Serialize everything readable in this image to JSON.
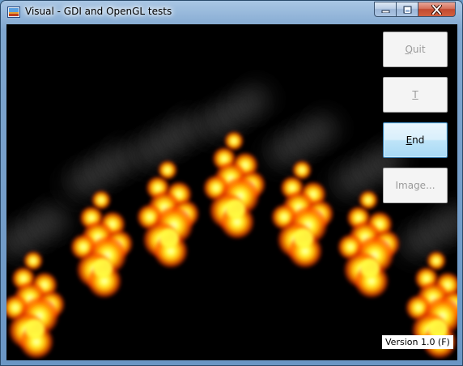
{
  "window": {
    "title": "Visual - GDI and OpenGL tests",
    "controls": {
      "minimize_icon": "minimize-icon",
      "maximize_icon": "maximize-icon",
      "close_icon": "close-icon"
    }
  },
  "buttons": {
    "quit": {
      "label": "Quit",
      "mnemonic": "Q",
      "rest": "uit"
    },
    "t": {
      "label": "T",
      "mnemonic": "T",
      "rest": ""
    },
    "end": {
      "label": "End",
      "mnemonic": "E",
      "rest": "nd"
    },
    "image": {
      "label": "Image...",
      "mnemonic": "",
      "rest": "Image..."
    }
  },
  "version_label": "Version 1.0 (F)",
  "colors": {
    "background": "#000000",
    "flame_core": "#ffff33",
    "flame_mid": "#ff9900",
    "flame_edge": "#ff3300",
    "smoke": "#5a5a5a",
    "accent_button": "#a7d9f5",
    "close_button": "#c24a2f"
  }
}
